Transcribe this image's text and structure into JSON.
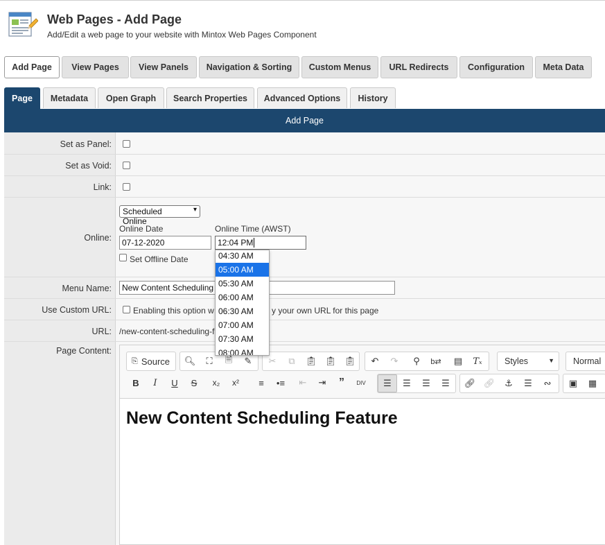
{
  "header": {
    "title": "Web Pages - Add Page",
    "subtitle": "Add/Edit a web page to your website with Mintox Web Pages Component"
  },
  "topnav": [
    "Add Page",
    "View Pages",
    "View Panels",
    "Navigation & Sorting",
    "Custom Menus",
    "URL Redirects",
    "Configuration",
    "Meta Data"
  ],
  "subtabs": [
    "Page",
    "Metadata",
    "Open Graph",
    "Search Properties",
    "Advanced Options",
    "History"
  ],
  "banner": "Add Page",
  "form": {
    "set_as_panel_label": "Set as Panel:",
    "set_as_void_label": "Set as Void:",
    "link_label": "Link:",
    "online_label": "Online:",
    "online_select": "Scheduled Online",
    "online_date_label": "Online Date",
    "online_date_value": "07-12-2020",
    "online_time_label": "Online Time (AWST)",
    "online_time_value": "12:04 PM",
    "set_offline_label": "Set Offline Date",
    "menu_name_label": "Menu Name:",
    "menu_name_value": "New Content Scheduling",
    "custom_url_label": "Use Custom URL:",
    "custom_url_text": "Enabling this option w",
    "custom_url_text_tail": "y your own URL for this page",
    "url_label": "URL:",
    "url_value": "/new-content-scheduling-f",
    "page_content_label": "Page Content:"
  },
  "time_options": [
    "04:30 AM",
    "05:00 AM",
    "05:30 AM",
    "06:00 AM",
    "06:30 AM",
    "07:00 AM",
    "07:30 AM",
    "08:00 AM"
  ],
  "time_selected": "05:00 AM",
  "editor": {
    "source_label": "Source",
    "styles_label": "Styles",
    "format_label": "Normal",
    "content_heading": "New Content Scheduling Feature"
  },
  "colors": {
    "brand_navy": "#1c476e",
    "dropdown_highlight": "#1a73e8"
  }
}
